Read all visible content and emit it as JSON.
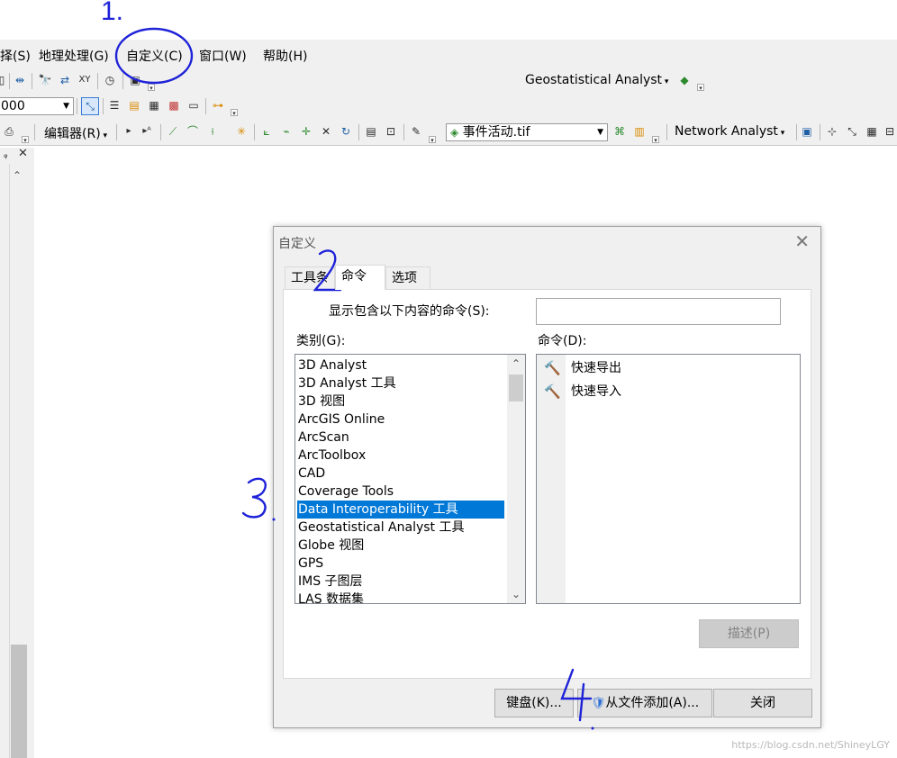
{
  "menubar": {
    "items": [
      "择(S)",
      "地理处理(G)",
      "自定义(C)",
      "窗口(W)",
      "帮助(H)"
    ]
  },
  "toolbar": {
    "scale_value": "000",
    "geostat_label": "Geostatistical Analyst",
    "editor_label": "编辑器(R)",
    "layer_combo": "事件活动.tif",
    "network_label": "Network Analyst"
  },
  "dialog": {
    "title": "自定义",
    "tabs": [
      "工具条",
      "命令",
      "选项"
    ],
    "active_tab": "命令",
    "search_label": "显示包含以下内容的命令(S):",
    "search_value": "",
    "category_label": "类别(G):",
    "command_label": "命令(D):",
    "categories": [
      "3D Analyst",
      "3D Analyst 工具",
      "3D 视图",
      "ArcGIS Online",
      "ArcScan",
      "ArcToolbox",
      "CAD",
      "Coverage Tools",
      "Data Interoperability 工具",
      "Geostatistical Analyst 工具",
      "Globe 视图",
      "GPS",
      "IMS 子图层",
      "LAS 数据集"
    ],
    "selected_category": "Data Interoperability 工具",
    "commands": [
      "快速导出",
      "快速导入"
    ],
    "describe_button": "描述(P)",
    "keyboard_button": "键盘(K)...",
    "add_from_file_button": "从文件添加(A)...",
    "close_button": "关闭"
  },
  "annotations": [
    "1.",
    "2.",
    "3.",
    "4."
  ],
  "watermark": "https://blog.csdn.net/ShineyLGY"
}
